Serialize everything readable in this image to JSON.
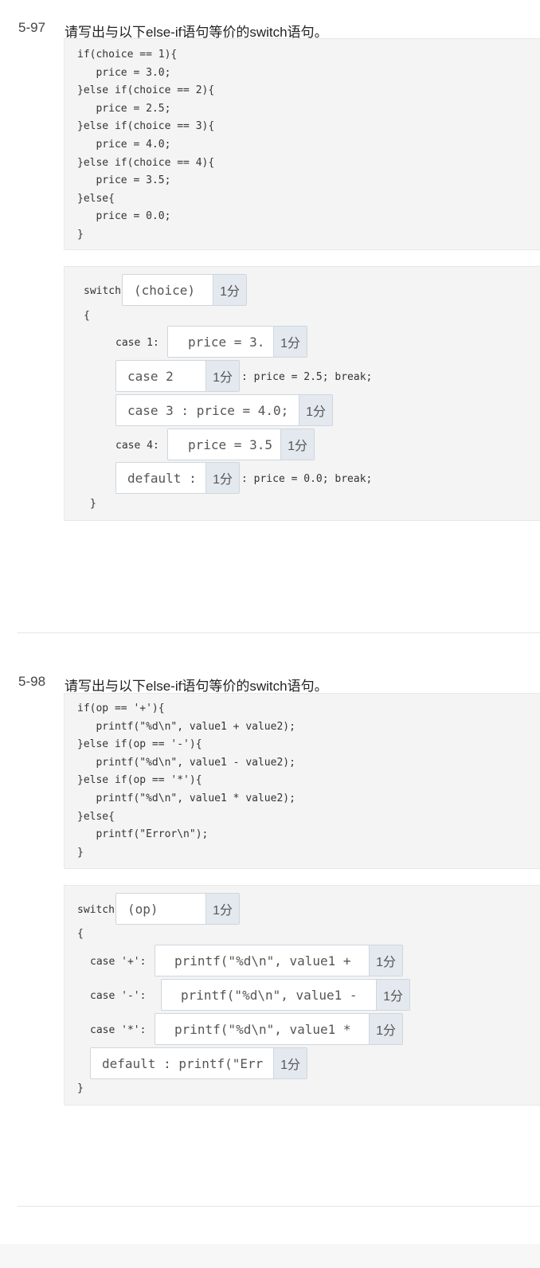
{
  "questions": [
    {
      "number": "5-97",
      "title": "请写出与以下else-if语句等价的switch语句。",
      "code_lines": [
        "if(choice == 1){",
        "   price = 3.0;",
        "}else if(choice == 2){",
        "   price = 2.5;",
        "}else if(choice == 3){",
        "   price = 4.0;",
        "}else if(choice == 4){",
        "   price = 3.5;",
        "}else{",
        "   price = 0.0;",
        "}"
      ],
      "answer": {
        "switch_kw": "switch",
        "open_brace": "{",
        "close_brace": "}",
        "case1_label": "case 1:",
        "case2_suffix": ": price = 2.5; break;",
        "case4_label": "case 4:",
        "default_suffix": ": price = 0.0; break;",
        "blanks": [
          {
            "value": "(choice)",
            "score": "1分"
          },
          {
            "value": "price = 3.",
            "score": "1分"
          },
          {
            "value": "case 2",
            "score": "1分"
          },
          {
            "value": "case 3 : price = 4.0;",
            "score": "1分"
          },
          {
            "value": "price = 3.5",
            "score": "1分"
          },
          {
            "value": "default :",
            "score": "1分"
          }
        ]
      }
    },
    {
      "number": "5-98",
      "title": "请写出与以下else-if语句等价的switch语句。",
      "code_lines": [
        "if(op == '+'){",
        "   printf(\"%d\\n\", value1 + value2);",
        "}else if(op == '-'){",
        "   printf(\"%d\\n\", value1 - value2);",
        "}else if(op == '*'){",
        "   printf(\"%d\\n\", value1 * value2);",
        "}else{",
        "   printf(\"Error\\n\");",
        "}"
      ],
      "answer": {
        "switch_kw": "switch",
        "open_brace": "{",
        "close_brace": "}",
        "case_plus_label": "case '+':",
        "case_minus_label": "case '-':",
        "case_mul_label": "case '*':",
        "blanks": [
          {
            "value": "(op)",
            "score": "1分"
          },
          {
            "value": "printf(\"%d\\n\", value1 +",
            "score": "1分"
          },
          {
            "value": "printf(\"%d\\n\", value1 -",
            "score": "1分"
          },
          {
            "value": "printf(\"%d\\n\", value1 *",
            "score": "1分"
          },
          {
            "value": "default : printf(\"Err",
            "score": "1分"
          }
        ]
      }
    }
  ]
}
